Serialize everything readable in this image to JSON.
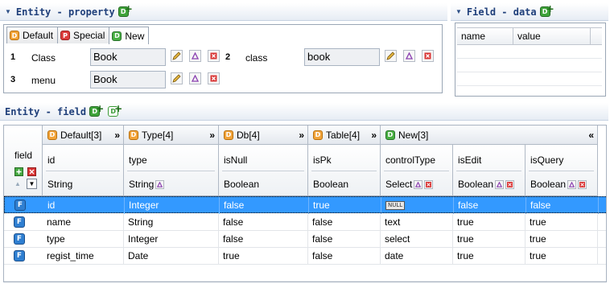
{
  "entity_property": {
    "title": "Entity - property",
    "tabs": [
      {
        "label": "Default",
        "icon": "D"
      },
      {
        "label": "Special",
        "icon": "P"
      },
      {
        "label": "New",
        "icon": "D"
      }
    ],
    "rows": [
      {
        "num": "1",
        "label": "Class",
        "value": "Book"
      },
      {
        "num": "2",
        "label": "class",
        "value": "book"
      },
      {
        "num": "3",
        "label": "menu",
        "value": "Book"
      }
    ]
  },
  "field_data": {
    "title": "Field - data",
    "columns": [
      "name",
      "value"
    ]
  },
  "entity_field": {
    "title": "Entity - field",
    "row_header_label": "field",
    "groups": [
      {
        "label": "Default[3]",
        "icon": "D",
        "arrow": "»"
      },
      {
        "label": "Type[4]",
        "icon": "D",
        "arrow": "»"
      },
      {
        "label": "Db[4]",
        "icon": "D",
        "arrow": "»"
      },
      {
        "label": "Table[4]",
        "icon": "D",
        "arrow": "»"
      },
      {
        "label": "New[3]",
        "icon": "D",
        "arrow": "«"
      }
    ],
    "columns": [
      {
        "name": "id",
        "type": "String"
      },
      {
        "name": "type",
        "type": "String"
      },
      {
        "name": "isNull",
        "type": "Boolean"
      },
      {
        "name": "isPk",
        "type": "Boolean"
      },
      {
        "name": "controlType",
        "type": "Select"
      },
      {
        "name": "isEdit",
        "type": "Boolean"
      },
      {
        "name": "isQuery",
        "type": "Boolean"
      }
    ],
    "rows": [
      {
        "icon": "F",
        "cells": [
          "id",
          "Integer",
          "false",
          "true",
          "NULL",
          "false",
          "false"
        ],
        "selected": true
      },
      {
        "icon": "F",
        "cells": [
          "name",
          "String",
          "false",
          "false",
          "text",
          "true",
          "true"
        ],
        "selected": false
      },
      {
        "icon": "F",
        "cells": [
          "type",
          "Integer",
          "false",
          "false",
          "select",
          "true",
          "true"
        ],
        "selected": false
      },
      {
        "icon": "F",
        "cells": [
          "regist_time",
          "Date",
          "true",
          "false",
          "date",
          "true",
          "true"
        ],
        "selected": false
      }
    ]
  },
  "colors": {
    "selection": "#3399ff",
    "title_text": "#1f3f7a"
  }
}
